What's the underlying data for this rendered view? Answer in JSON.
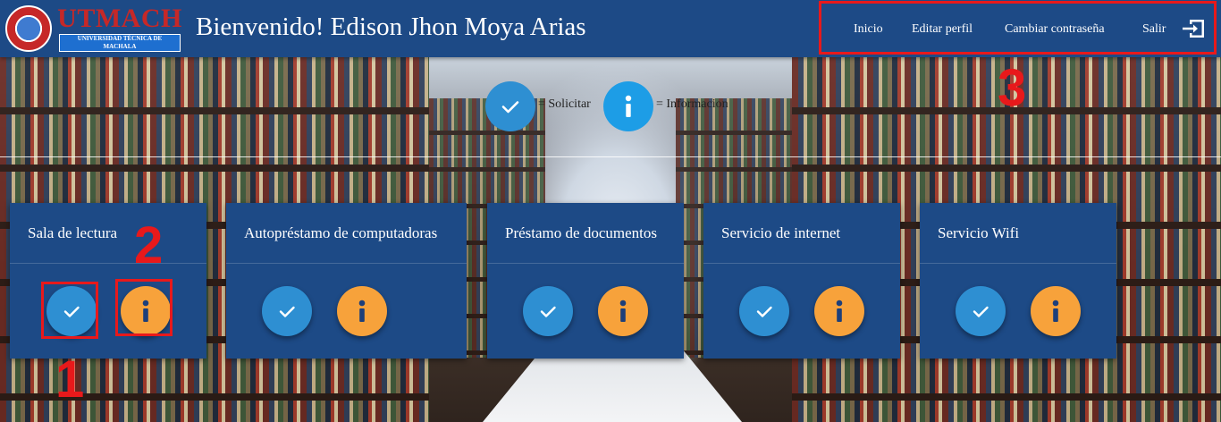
{
  "header": {
    "logo_word": "UTMACH",
    "logo_subtitle_line1": "UNIVERSIDAD TÉCNICA DE",
    "logo_subtitle_line2": "MACHALA",
    "welcome": "Bienvenido! Edison Jhon Moya Arias",
    "nav": [
      {
        "label": "Inicio"
      },
      {
        "label": "Editar perfil"
      },
      {
        "label": "Cambiar contraseña"
      },
      {
        "label": "Salir"
      }
    ],
    "exit_icon": "exit-to-app-icon"
  },
  "legend": {
    "request_text": "= Solicitar",
    "info_text": "= Informacion"
  },
  "services": [
    {
      "title": "Sala de lectura"
    },
    {
      "title": "Autopréstamo de computadoras"
    },
    {
      "title": "Préstamo de documentos"
    },
    {
      "title": "Servicio de internet"
    },
    {
      "title": "Servicio Wifi"
    }
  ],
  "annotations": {
    "one": "1",
    "two": "2",
    "three": "3",
    "color": "#e8191b"
  },
  "colors": {
    "header_bg": "#1d4a86",
    "card_bg": "#1d4a86",
    "request_button": "#2e8fd2",
    "info_button": "#f7a23b",
    "legend_info": "#1d9de6"
  }
}
